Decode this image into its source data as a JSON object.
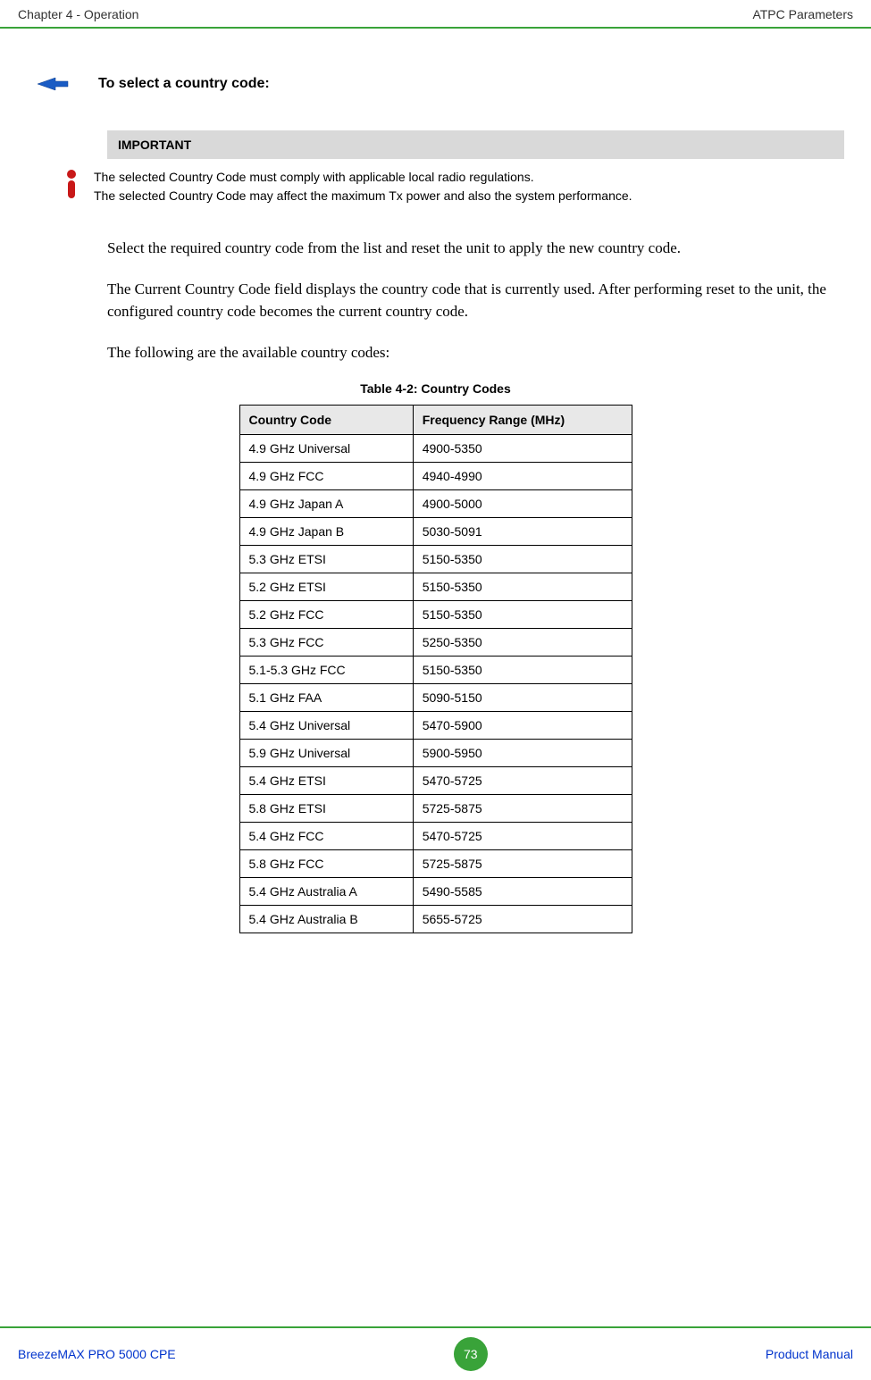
{
  "header": {
    "left": "Chapter 4 - Operation",
    "right": "ATPC Parameters"
  },
  "arrow_heading": "To select a country code:",
  "important": {
    "label": "IMPORTANT",
    "line1": "The selected Country Code must comply with applicable local radio regulations.",
    "line2": "The selected Country Code may affect the maximum Tx power and also the system performance."
  },
  "para1": "Select the required country code from the list and reset the unit to apply the new country code.",
  "para2": "The Current Country Code field displays the country code that is currently used. After performing reset to the unit, the configured country code becomes the current country code.",
  "para3": "The following are the available country codes:",
  "table": {
    "caption": "Table 4-2: Country Codes",
    "headers": [
      "Country Code",
      "Frequency Range (MHz)"
    ],
    "rows": [
      [
        "4.9 GHz Universal",
        "4900-5350"
      ],
      [
        "4.9 GHz FCC",
        "4940-4990"
      ],
      [
        "4.9 GHz Japan A",
        "4900-5000"
      ],
      [
        "4.9 GHz Japan B",
        "5030-5091"
      ],
      [
        "5.3 GHz ETSI",
        "5150-5350"
      ],
      [
        "5.2 GHz ETSI",
        "5150-5350"
      ],
      [
        "5.2 GHz FCC",
        "5150-5350"
      ],
      [
        "5.3 GHz FCC",
        "5250-5350"
      ],
      [
        "5.1-5.3 GHz FCC",
        "5150-5350"
      ],
      [
        "5.1 GHz FAA",
        "5090-5150"
      ],
      [
        "5.4 GHz Universal",
        "5470-5900"
      ],
      [
        "5.9 GHz Universal",
        "5900-5950"
      ],
      [
        "5.4 GHz ETSI",
        "5470-5725"
      ],
      [
        "5.8 GHz ETSI",
        "5725-5875"
      ],
      [
        "5.4 GHz FCC",
        "5470-5725"
      ],
      [
        "5.8 GHz FCC",
        "5725-5875"
      ],
      [
        "5.4 GHz Australia A",
        "5490-5585"
      ],
      [
        "5.4 GHz Australia B",
        "5655-5725"
      ]
    ]
  },
  "footer": {
    "left": "BreezeMAX PRO 5000 CPE",
    "page": "73",
    "right": "Product Manual"
  }
}
